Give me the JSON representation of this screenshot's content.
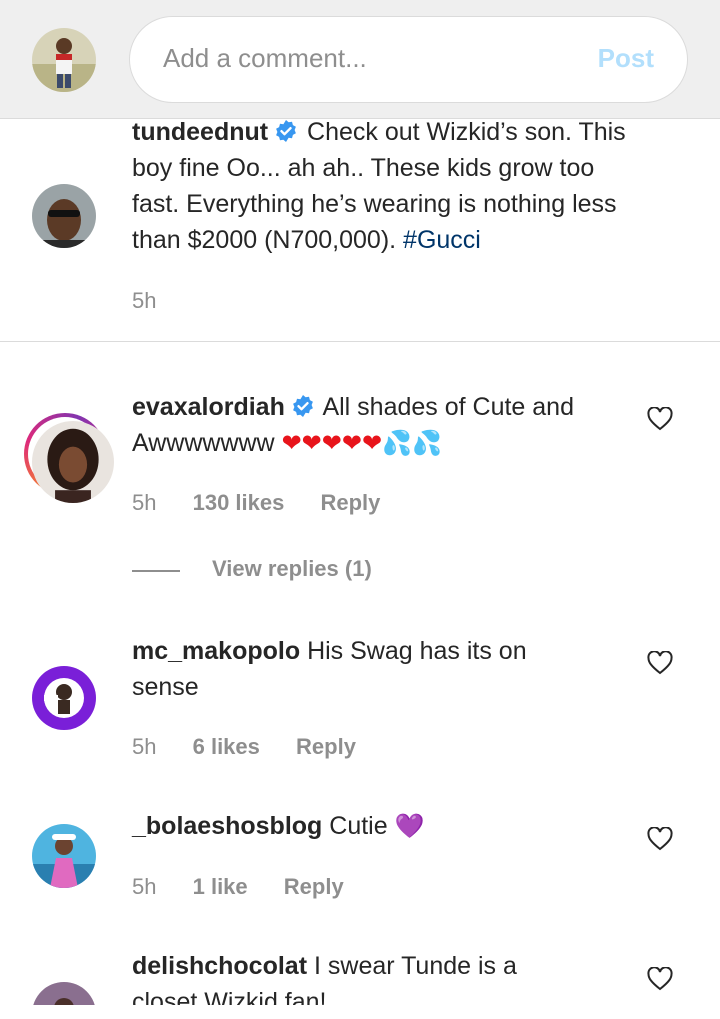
{
  "composer": {
    "placeholder": "Add a comment...",
    "post_label": "Post"
  },
  "caption": {
    "username": "tundeednut",
    "verified": true,
    "text_1": "Check out Wizkid’s son. This",
    "text_2": "boy fine Oo... ah ah.. These kids grow too",
    "text_3": "fast. Everything he’s wearing is nothing less",
    "text_4": "than $2000 (N700,000).",
    "hashtag": "#Gucci",
    "time": "5h"
  },
  "comments": [
    {
      "username": "evaxalordiah",
      "verified": true,
      "text_1": "All shades of Cute and",
      "text_2": "Awwwwwww",
      "emojis": "❤❤❤❤❤",
      "emojis_2": "💦💦",
      "time": "5h",
      "likes": "130 likes",
      "reply": "Reply",
      "view_replies": "View replies (1)"
    },
    {
      "username": "mc_makopolo",
      "text_1": "His Swag has its on",
      "text_2": "sense",
      "time": "5h",
      "likes": "6 likes",
      "reply": "Reply"
    },
    {
      "username": "_bolaeshosblog",
      "text_1": "Cutie",
      "emoji": "💜",
      "time": "5h",
      "likes": "1 like",
      "reply": "Reply"
    },
    {
      "username": "delishchocolat",
      "text_1": "I swear Tunde is a",
      "text_2": "closet Wizkid fan!"
    }
  ],
  "colors": {
    "accent_blue": "#3897f0",
    "post_disabled": "#b2dffc",
    "hashtag": "#003569",
    "muted": "#8e8e8e"
  },
  "icons": [
    "verified-badge-icon",
    "heart-outline-icon"
  ]
}
